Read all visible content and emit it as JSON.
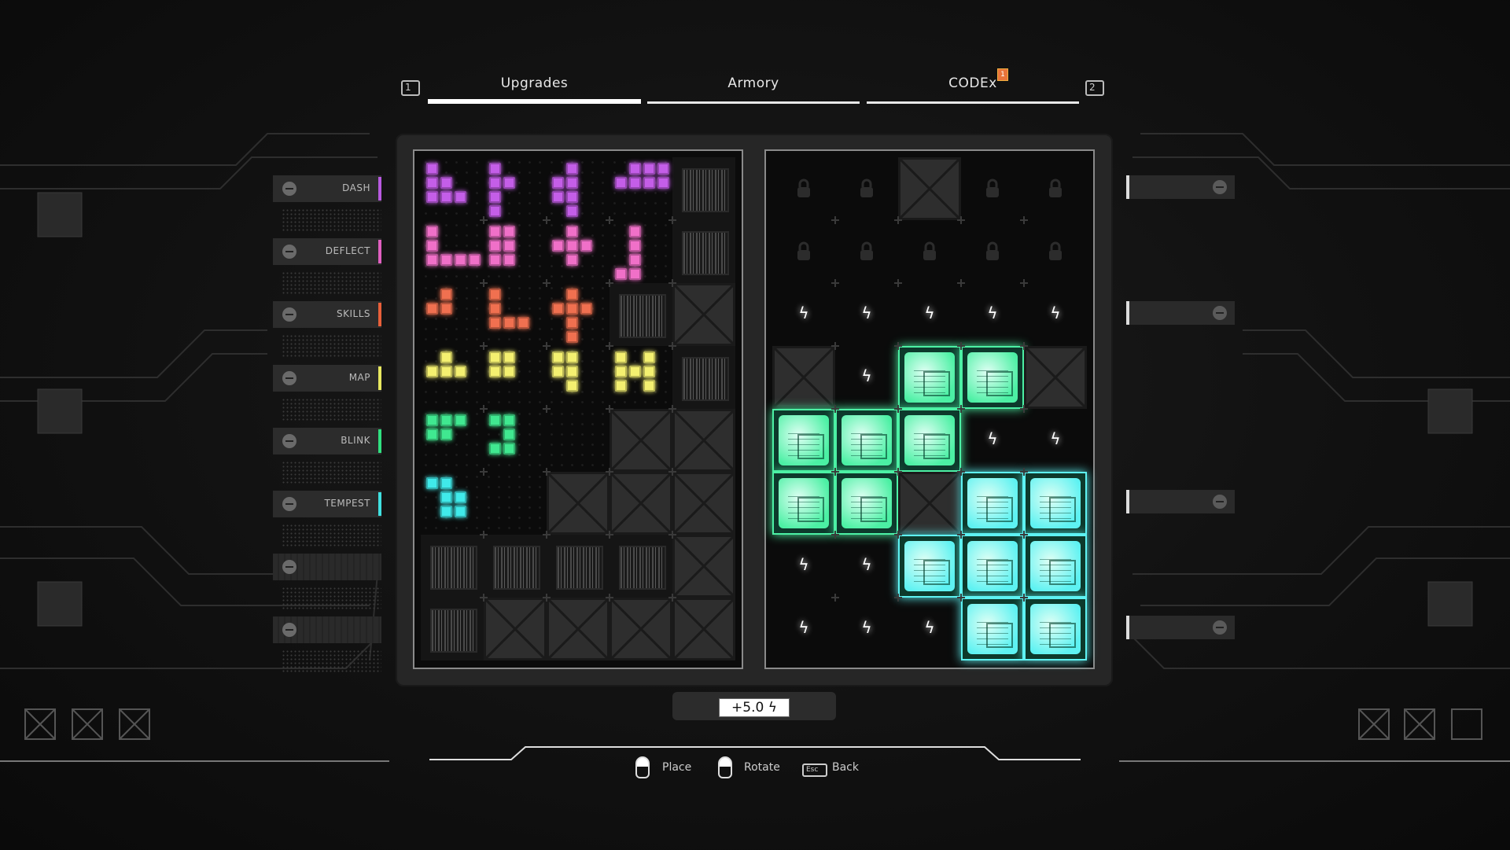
{
  "tabs": {
    "left_key": "1",
    "right_key": "2",
    "items": [
      {
        "label": "Upgrades",
        "active": true
      },
      {
        "label": "Armory",
        "active": false
      },
      {
        "label": "CODEx",
        "active": false,
        "badge": "1"
      }
    ]
  },
  "sidebar": {
    "items": [
      {
        "label": "DASH",
        "color": "#b85ae0"
      },
      {
        "label": "DEFLECT",
        "color": "#e060c0"
      },
      {
        "label": "SKILLS",
        "color": "#e8603a"
      },
      {
        "label": "MAP",
        "color": "#e8e860"
      },
      {
        "label": "BLINK",
        "color": "#30e080"
      },
      {
        "label": "TEMPEST",
        "color": "#40e0e0"
      },
      {
        "label": "",
        "color": ""
      },
      {
        "label": "",
        "color": ""
      }
    ]
  },
  "inventory_grid": {
    "cells": [
      "eeeeb",
      "eeeeb",
      "eeebx",
      "eeeeb",
      "eeexx",
      "eexxx",
      "bbbbx",
      "bxxxx"
    ],
    "pieces": [
      {
        "color": "#c45ee8",
        "row": 0,
        "col": 0,
        "shape": [
          [
            0,
            0
          ],
          [
            0,
            1
          ],
          [
            1,
            1
          ],
          [
            0,
            2
          ],
          [
            1,
            2
          ],
          [
            2,
            2
          ]
        ]
      },
      {
        "color": "#c45ee8",
        "row": 0,
        "col": 1,
        "shape": [
          [
            0,
            0
          ],
          [
            0,
            1
          ],
          [
            1,
            1
          ],
          [
            0,
            2
          ],
          [
            0,
            3
          ]
        ]
      },
      {
        "color": "#c45ee8",
        "row": 0,
        "col": 2,
        "shape": [
          [
            1,
            0
          ],
          [
            0,
            1
          ],
          [
            1,
            1
          ],
          [
            0,
            2
          ],
          [
            1,
            2
          ],
          [
            1,
            3
          ]
        ]
      },
      {
        "color": "#c45ee8",
        "row": 0,
        "col": 3,
        "shape": [
          [
            1,
            0
          ],
          [
            2,
            0
          ],
          [
            3,
            0
          ],
          [
            0,
            1
          ],
          [
            1,
            1
          ],
          [
            2,
            1
          ],
          [
            3,
            1
          ]
        ]
      },
      {
        "color": "#f070c8",
        "row": 1,
        "col": 0,
        "shape": [
          [
            0,
            0
          ],
          [
            0,
            1
          ],
          [
            0,
            2
          ],
          [
            1,
            2
          ],
          [
            2,
            2
          ],
          [
            3,
            2
          ]
        ]
      },
      {
        "color": "#f070c8",
        "row": 1,
        "col": 1,
        "shape": [
          [
            0,
            0
          ],
          [
            1,
            0
          ],
          [
            0,
            1
          ],
          [
            1,
            1
          ],
          [
            0,
            2
          ],
          [
            1,
            2
          ]
        ]
      },
      {
        "color": "#f070c8",
        "row": 1,
        "col": 2,
        "shape": [
          [
            1,
            0
          ],
          [
            0,
            1
          ],
          [
            1,
            1
          ],
          [
            2,
            1
          ],
          [
            1,
            2
          ]
        ]
      },
      {
        "color": "#f070c8",
        "row": 1,
        "col": 3,
        "shape": [
          [
            1,
            0
          ],
          [
            1,
            1
          ],
          [
            1,
            2
          ],
          [
            0,
            3
          ],
          [
            1,
            3
          ]
        ]
      },
      {
        "color": "#f07050",
        "row": 2,
        "col": 0,
        "shape": [
          [
            1,
            0
          ],
          [
            0,
            1
          ],
          [
            1,
            1
          ]
        ]
      },
      {
        "color": "#f07050",
        "row": 2,
        "col": 1,
        "shape": [
          [
            0,
            0
          ],
          [
            0,
            1
          ],
          [
            0,
            2
          ],
          [
            1,
            2
          ],
          [
            2,
            2
          ]
        ]
      },
      {
        "color": "#f07050",
        "row": 2,
        "col": 2,
        "shape": [
          [
            1,
            0
          ],
          [
            0,
            1
          ],
          [
            1,
            1
          ],
          [
            2,
            1
          ],
          [
            1,
            2
          ],
          [
            1,
            3
          ]
        ]
      },
      {
        "color": "#f4f070",
        "row": 3,
        "col": 0,
        "shape": [
          [
            1,
            0
          ],
          [
            0,
            1
          ],
          [
            1,
            1
          ],
          [
            2,
            1
          ]
        ]
      },
      {
        "color": "#f4f070",
        "row": 3,
        "col": 1,
        "shape": [
          [
            0,
            0
          ],
          [
            1,
            0
          ],
          [
            0,
            1
          ],
          [
            1,
            1
          ]
        ]
      },
      {
        "color": "#f4f070",
        "row": 3,
        "col": 2,
        "shape": [
          [
            0,
            0
          ],
          [
            1,
            0
          ],
          [
            0,
            1
          ],
          [
            1,
            1
          ],
          [
            1,
            2
          ]
        ]
      },
      {
        "color": "#f4f070",
        "row": 3,
        "col": 3,
        "shape": [
          [
            0,
            0
          ],
          [
            2,
            0
          ],
          [
            0,
            1
          ],
          [
            1,
            1
          ],
          [
            2,
            1
          ],
          [
            0,
            2
          ],
          [
            2,
            2
          ]
        ]
      },
      {
        "color": "#40e890",
        "row": 4,
        "col": 0,
        "shape": [
          [
            0,
            0
          ],
          [
            1,
            0
          ],
          [
            2,
            0
          ],
          [
            0,
            1
          ],
          [
            1,
            1
          ]
        ]
      },
      {
        "color": "#40e890",
        "row": 4,
        "col": 1,
        "shape": [
          [
            0,
            0
          ],
          [
            1,
            0
          ],
          [
            1,
            1
          ],
          [
            0,
            2
          ],
          [
            1,
            2
          ]
        ]
      },
      {
        "color": "#40eaea",
        "row": 5,
        "col": 0,
        "shape": [
          [
            0,
            0
          ],
          [
            1,
            0
          ],
          [
            1,
            1
          ],
          [
            2,
            1
          ],
          [
            1,
            2
          ],
          [
            2,
            2
          ]
        ]
      }
    ]
  },
  "board_grid": {
    "cells": [
      "llxll",
      "lllll",
      "zzzzz",
      "xzggx",
      "gggzz",
      "ggxcc",
      "zzccc",
      "zzzcc"
    ],
    "module_colors": {
      "g": "#4cf0a4",
      "c": "#5ef2f2"
    }
  },
  "energy": {
    "value": "+5.0",
    "icon": "lightning-icon"
  },
  "controls": [
    {
      "label": "Place",
      "icon": "mouse-left-icon"
    },
    {
      "label": "Rotate",
      "icon": "mouse-right-icon"
    },
    {
      "label": "Back",
      "key": "Esc"
    }
  ]
}
